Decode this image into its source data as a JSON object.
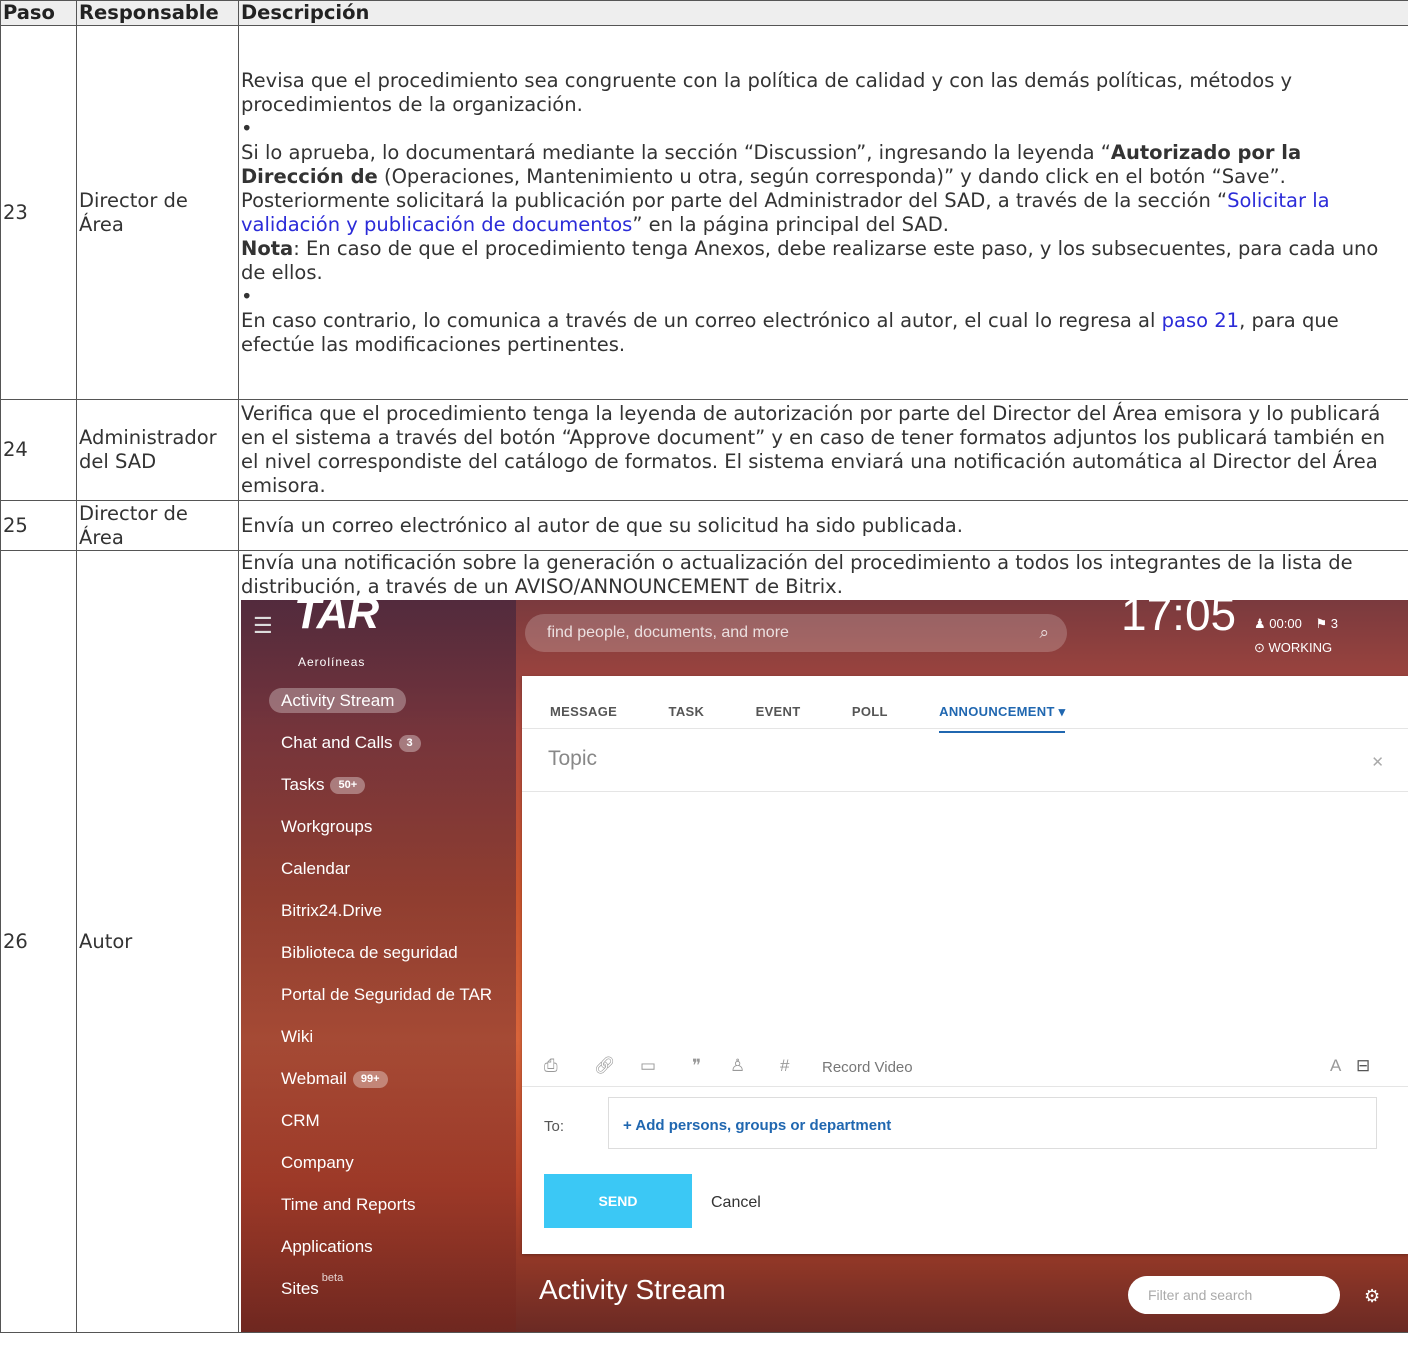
{
  "table": {
    "headers": [
      "Paso",
      "Responsable",
      "Descripción"
    ],
    "rows": [
      {
        "paso": "23",
        "responsable": "Director de Área",
        "p1": "Revisa que el procedimiento sea congruente con la política de calidad y con las demás políticas, métodos y procedimientos de la organización.",
        "bullet": "•",
        "p2_a": "Si lo aprueba, lo documentará mediante la sección “Discussion”, ingresando la leyenda “",
        "p2_bold": "Autorizado por la Dirección de",
        "p2_b": " (Operaciones, Mantenimiento u otra, según corresponda)” y dando click en el botón “Save”. Posteriormente solicitará la publicación por parte del Administrador del SAD, a través de la sección “",
        "p2_link": "Solicitar la validación y publicación de documentos",
        "p2_c": "” en la página principal del SAD.",
        "nota_label": "Nota",
        "nota_text": ": En caso de que el procedimiento tenga Anexos, debe realizarse este paso, y los subsecuentes, para cada uno de ellos.",
        "p3_a": "En caso contrario, lo comunica a través de un correo electrónico al autor, el cual lo regresa al ",
        "p3_link": "paso 21",
        "p3_b": ", para que efectúe las modificaciones pertinentes."
      },
      {
        "paso": "24",
        "responsable": "Administrador del SAD",
        "descripcion": "Verifica que el procedimiento tenga la leyenda de autorización por parte del Director del Área emisora y lo publicará en el sistema a través del botón “Approve document” y en caso de tener formatos adjuntos los publicará también en el nivel correspondiste del catálogo de formatos. El sistema enviará una notificación automática al Director del Área emisora."
      },
      {
        "paso": "25",
        "responsable": "Director de Área",
        "descripcion": "Envía un correo electrónico al autor de que su solicitud ha sido publicada."
      },
      {
        "paso": "26",
        "responsable": "Autor",
        "descripcion": "Envía una notificación sobre la generación o actualización del procedimiento a todos los integrantes de la lista de distribución, a través de un AVISO/ANNOUNCEMENT de Bitrix."
      }
    ]
  },
  "screenshot": {
    "logo": "TAR",
    "logo_sub": "Aerolíneas",
    "search_placeholder": "find people, documents, and more",
    "clock": "17:05",
    "timer": "00:00",
    "flag_count": "3",
    "status": "WORKING",
    "nav": [
      {
        "label": "Activity Stream",
        "badge": ""
      },
      {
        "label": "Chat and Calls",
        "badge": "3"
      },
      {
        "label": "Tasks",
        "badge": "50+"
      },
      {
        "label": "Workgroups",
        "badge": ""
      },
      {
        "label": "Calendar",
        "badge": ""
      },
      {
        "label": "Bitrix24.Drive",
        "badge": ""
      },
      {
        "label": "Biblioteca de seguridad",
        "badge": ""
      },
      {
        "label": "Portal de Seguridad de TAR",
        "badge": ""
      },
      {
        "label": "Wiki",
        "badge": ""
      },
      {
        "label": "Webmail",
        "badge": "99+"
      },
      {
        "label": "CRM",
        "badge": ""
      },
      {
        "label": "Company",
        "badge": ""
      },
      {
        "label": "Time and Reports",
        "badge": ""
      },
      {
        "label": "Applications",
        "badge": ""
      },
      {
        "label": "Sites",
        "badge": ""
      }
    ],
    "sites_beta": "beta",
    "tabs": [
      "MESSAGE",
      "TASK",
      "EVENT",
      "POLL",
      "ANNOUNCEMENT"
    ],
    "topic_placeholder": "Topic",
    "record_video": "Record Video",
    "to_label": "To:",
    "add_persons": "+ Add persons, groups or department",
    "send": "SEND",
    "cancel": "Cancel",
    "activity_stream_title": "Activity Stream",
    "filter_placeholder": "Filter and search"
  }
}
